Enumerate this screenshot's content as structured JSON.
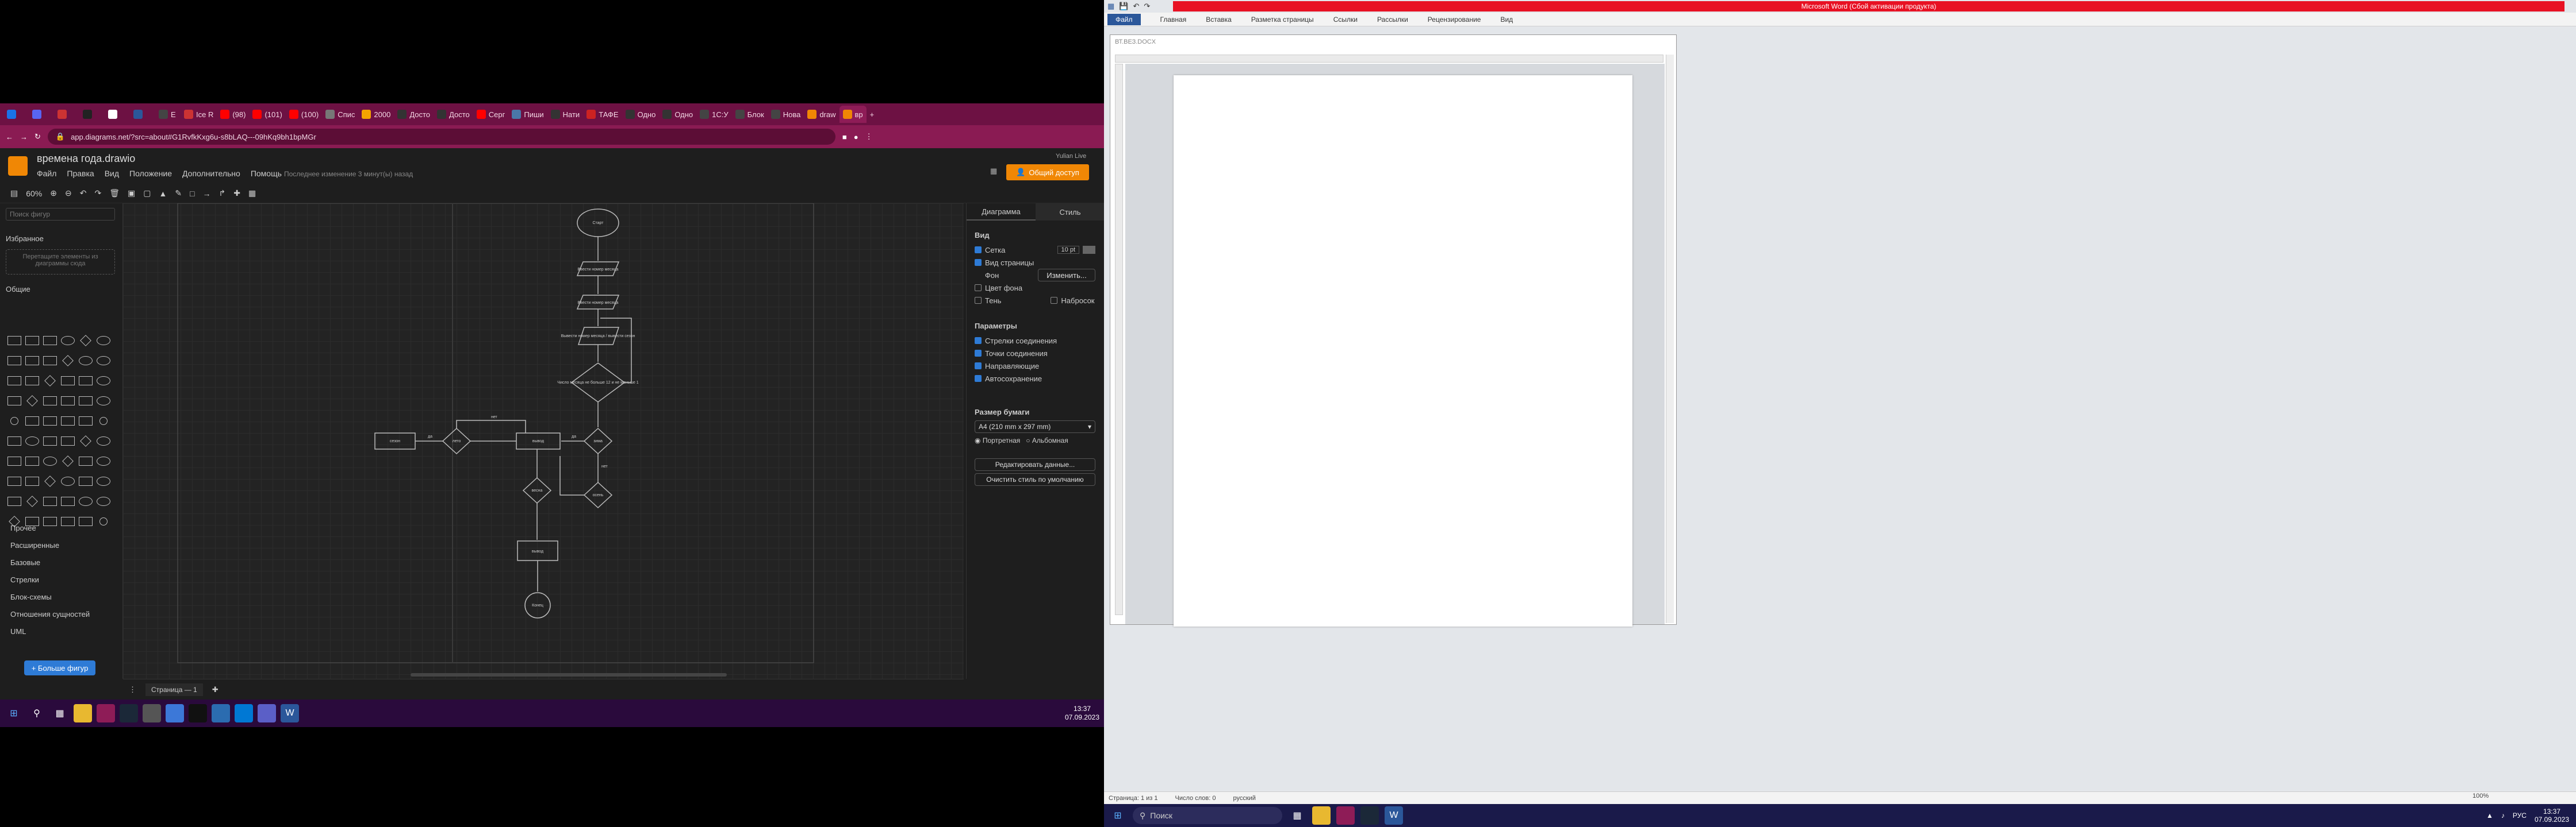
{
  "browser": {
    "tabs": [
      {
        "label": "",
        "color": "#1a73e8"
      },
      {
        "label": "",
        "color": "#5865f2"
      },
      {
        "label": "",
        "color": "#cc3333"
      },
      {
        "label": "",
        "color": "#222222"
      },
      {
        "label": "",
        "color": "#ffffff"
      },
      {
        "label": "",
        "color": "#2b579a"
      },
      {
        "label": "E",
        "color": "#444444"
      },
      {
        "label": "Ice R",
        "color": "#cc3333"
      },
      {
        "label": "(98)",
        "color": "#ff0000"
      },
      {
        "label": "(101)",
        "color": "#ff0000"
      },
      {
        "label": "(100)",
        "color": "#ff0000"
      },
      {
        "label": "Спис",
        "color": "#777777"
      },
      {
        "label": "2000",
        "color": "#f4a300"
      },
      {
        "label": "Досто",
        "color": "#333333"
      },
      {
        "label": "Досто",
        "color": "#333333"
      },
      {
        "label": "Серг",
        "color": "#ff0000"
      },
      {
        "label": "Пиши",
        "color": "#4a76a8"
      },
      {
        "label": "Нати",
        "color": "#333333"
      },
      {
        "label": "ТАФЕ",
        "color": "#cc2222"
      },
      {
        "label": "Одно",
        "color": "#333333"
      },
      {
        "label": "Одно",
        "color": "#333333"
      },
      {
        "label": "1С:У",
        "color": "#444444"
      },
      {
        "label": "Блок",
        "color": "#444444"
      },
      {
        "label": "Нова",
        "color": "#444444"
      },
      {
        "label": "draw",
        "color": "#f08705"
      },
      {
        "label": "вр",
        "color": "#f08705",
        "active": true
      }
    ],
    "new_tab": "+",
    "url": "app.diagrams.net/?src=about#G1RvfkKxg6u-s8bLAQ---09hKq9bh1bpMGr"
  },
  "drawio": {
    "file_title": "времена года.drawio",
    "menu": [
      "Файл",
      "Правка",
      "Вид",
      "Положение",
      "Дополнительно",
      "Помощь"
    ],
    "last_change": "Последнее изменение 3 минут(ы) назад",
    "share_label": "Общий доступ",
    "user": "Yulian Live",
    "zoom": "60%",
    "left": {
      "search_placeholder": "Поиск фигур",
      "favorites": "Избранное",
      "favorites_hint": "Перетащите элементы из диаграммы сюда",
      "general": "Общие",
      "categories": [
        "Прочее",
        "Расширенные",
        "Базовые",
        "Стрелки",
        "Блок-схемы",
        "Отношения сущностей",
        "UML"
      ],
      "more_shapes": "+ Больше фигур"
    },
    "right": {
      "tab_diagram": "Диаграмма",
      "tab_style": "Стиль",
      "view_section": "Вид",
      "grid": "Сетка",
      "grid_size": "10 pt",
      "page_view": "Вид страницы",
      "background": "Фон",
      "change": "Изменить...",
      "bg_color": "Цвет фона",
      "shadow": "Тень",
      "sketch": "Набросок",
      "options_section": "Параметры",
      "connection_arrows": "Стрелки соединения",
      "connection_points": "Точки соединения",
      "guides": "Направляющие",
      "autosave": "Автосохранение",
      "paper_size": "Размер бумаги",
      "paper_value": "A4 (210 mm x 297 mm)",
      "portrait": "Портретная",
      "landscape": "Альбомная",
      "edit_data": "Редактировать данные...",
      "clear_style": "Очистить стиль по умолчанию"
    },
    "page_tab": "Страница — 1",
    "flowchart": {
      "start": "Старт",
      "input1": "Ввести номер месяца",
      "input2": "Ввести номер месяца",
      "process1": "Вывести номер месяца / вывести сезон",
      "decision1": "Число месяца не больше 12 и не меньше 1",
      "process2": "вывод",
      "process3": "сезон",
      "decision2": "зима",
      "decision3": "лето",
      "decision4": "весна",
      "decision5": "осень",
      "output": "вывод",
      "end": "Конец",
      "yes": "да",
      "no": "нет"
    }
  },
  "taskbar1": {
    "time": "13:37",
    "date": "07.09.2023"
  },
  "word": {
    "title": "Microsoft Word (Сбой активации продукта)",
    "tabs": [
      "Файл",
      "Главная",
      "Вставка",
      "Разметка страницы",
      "Ссылки",
      "Рассылки",
      "Рецензирование",
      "Вид"
    ],
    "doc_name": "ВТ.ВЕЗ.DOCX",
    "status": [
      "Страница: 1 из 1",
      "Число слов: 0",
      "русский"
    ],
    "zoom": "100%"
  },
  "taskbar2": {
    "search": "Поиск",
    "lang": "РУС",
    "time": "13:37",
    "date": "07.09.2023"
  }
}
